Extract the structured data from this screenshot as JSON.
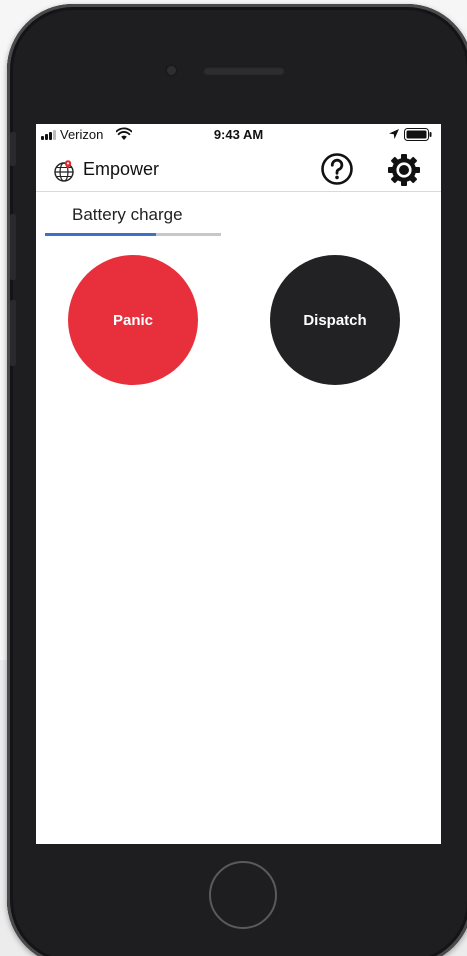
{
  "status_bar": {
    "carrier": "Verizon",
    "time": "9:43 AM",
    "icons": [
      "signal-icon",
      "wifi-icon",
      "location-icon",
      "battery-icon"
    ]
  },
  "header": {
    "title": "Empower",
    "logo_icon": "globe-pin-icon",
    "help_icon": "question-circle-icon",
    "settings_icon": "gear-icon"
  },
  "tab": {
    "label": "Battery charge",
    "progress": 0.63,
    "colors": {
      "fill": "#3b73c4",
      "track": "#c7c7c9"
    }
  },
  "actions": {
    "panic": {
      "label": "Panic",
      "color": "#e8303c"
    },
    "dispatch": {
      "label": "Dispatch",
      "color": "#222224"
    }
  }
}
